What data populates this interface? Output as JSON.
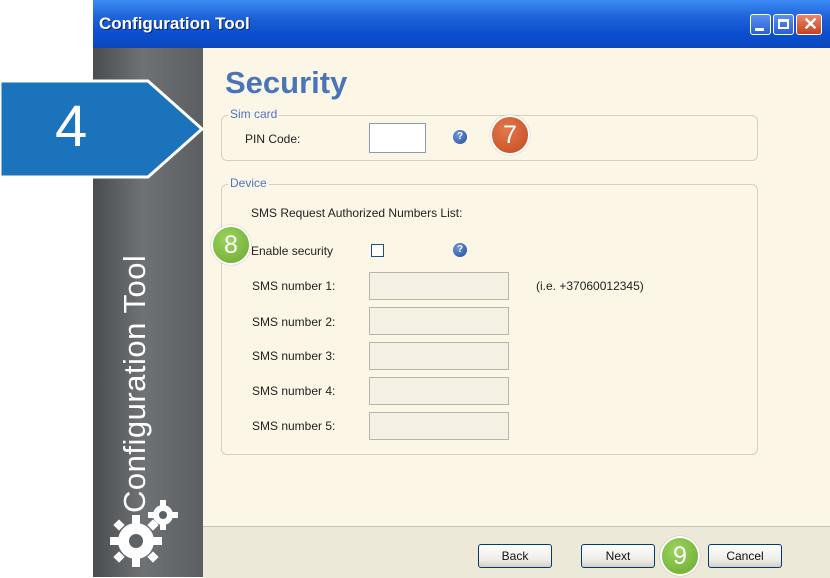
{
  "window": {
    "title": "Configuration Tool",
    "side_label": "Configuration Tool"
  },
  "page": {
    "heading": "Security"
  },
  "sim_card": {
    "legend": "Sim card",
    "pin_label": "PIN Code:",
    "pin_value": ""
  },
  "device": {
    "legend": "Device",
    "list_label": "SMS Request Authorized Numbers List:",
    "enable_label": "Enable security",
    "enable_checked": false,
    "example_hint": "(i.e. +37060012345)",
    "sms_numbers": [
      {
        "label": "SMS number 1:",
        "value": ""
      },
      {
        "label": "SMS number 2:",
        "value": ""
      },
      {
        "label": "SMS number 3:",
        "value": ""
      },
      {
        "label": "SMS number 4:",
        "value": ""
      },
      {
        "label": "SMS number 5:",
        "value": ""
      }
    ]
  },
  "buttons": {
    "back": "Back",
    "next": "Next",
    "cancel": "Cancel"
  },
  "callouts": {
    "step": "4",
    "pin": "7",
    "enable": "8",
    "next": "9"
  },
  "colors": {
    "arrow": "#1a73bb",
    "badge_red": "#d2582b",
    "badge_green": "#86c043",
    "heading": "#4a74b8"
  }
}
